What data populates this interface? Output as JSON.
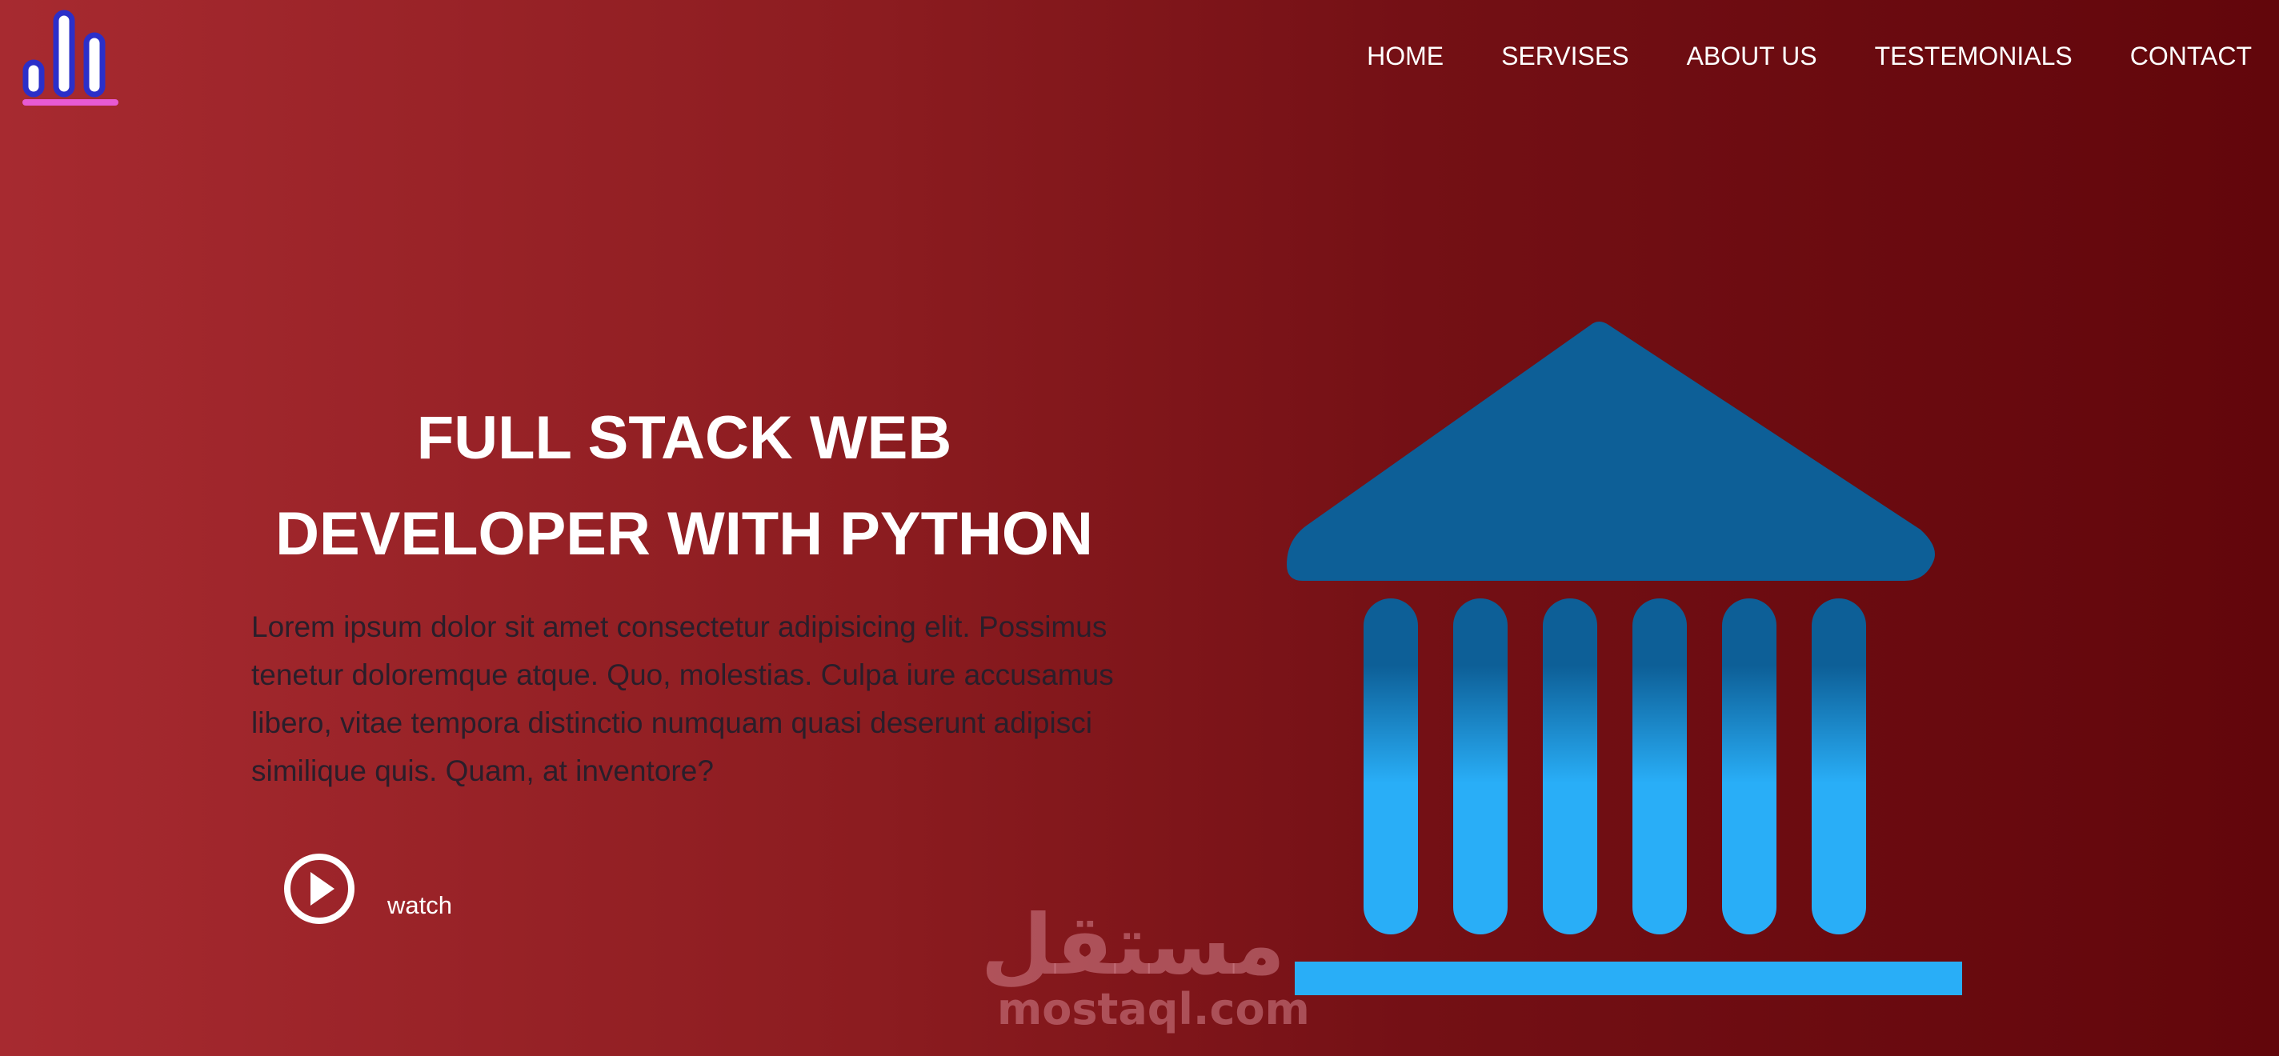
{
  "header": {
    "logo_icon": "bar-chart-logo-icon",
    "nav": [
      {
        "label": "HOME"
      },
      {
        "label": "SERVISES"
      },
      {
        "label": "ABOUT US"
      },
      {
        "label": "TESTEMONIALS"
      },
      {
        "label": "CONTACT"
      }
    ]
  },
  "hero": {
    "title_line1": "FULL STACK WEB",
    "title_line2": "DEVELOPER WITH PYTHON",
    "description": "Lorem ipsum dolor sit amet consectetur adipisicing elit. Possimus tenetur doloremque atque. Quo, molestias. Culpa iure accusamus libero, vitae tempora distinctio numquam quasi deserunt adipisci similique quis. Quam, at inventore?",
    "watch_label": "watch",
    "play_icon": "play-circle-icon"
  },
  "illustration": {
    "icon": "bank-building-icon",
    "roof_color": "#0d5f97",
    "column_color": "#29aef7",
    "base_color": "#29aef7"
  },
  "watermark": {
    "arabic": "مستقل",
    "latin": "mostaql.com"
  },
  "colors": {
    "background_start": "#a72a30",
    "background_end": "#62060b",
    "logo_outline": "#2b2fc9",
    "logo_underline": "#e85ad3",
    "text_light": "#ffffff",
    "text_dark": "#2a1e2a"
  }
}
